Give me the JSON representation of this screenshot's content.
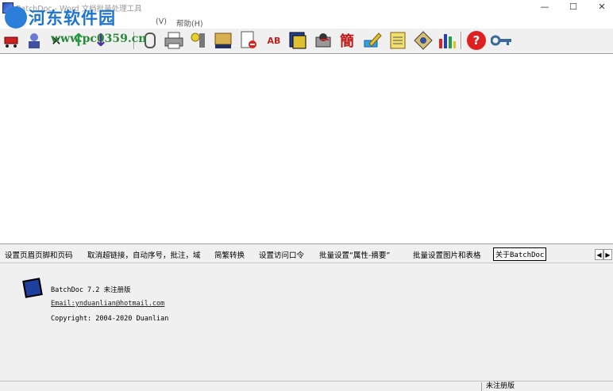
{
  "window": {
    "title": "BatchDoc - Word 文档批量处理工具",
    "minimize": "—",
    "maximize": "☐",
    "close": "✕"
  },
  "menu": {
    "items": [
      "(V)",
      "帮助(H)"
    ]
  },
  "watermark": {
    "text": "河东软件园",
    "url": "www.pc0359.cn"
  },
  "toolbar": {
    "icons": [
      "cart-icon",
      "user-icon",
      "delete-icon",
      "up-arrow-icon",
      "down-arrow-icon",
      "clip-icon",
      "printer-icon",
      "tools-icon",
      "name-card-icon",
      "stop-doc-icon",
      "ab-replace-icon",
      "word-icon",
      "disk-icon",
      "traditional-char-icon",
      "pencil-icon",
      "notepad-icon",
      "compass-icon",
      "chart-icon",
      "help-icon",
      "key-icon"
    ],
    "glyphs": {
      "delete": "✕",
      "up": "↑",
      "down": "↓",
      "ab": "AB",
      "trad": "簡",
      "help": "?"
    }
  },
  "tabs": [
    {
      "label": "设置页眉页脚和页码",
      "active": false
    },
    {
      "label": "取消超链接，自动序号，批注，域",
      "active": false
    },
    {
      "label": "简繁转换",
      "active": false
    },
    {
      "label": "设置访问口令",
      "active": false
    },
    {
      "label": "批量设置“属性-摘要”",
      "active": false
    },
    {
      "label": "批量设置图片和表格",
      "active": false
    },
    {
      "label": "关于BatchDoc",
      "active": true
    }
  ],
  "tab_scroll": {
    "left": "◀",
    "right": "▶"
  },
  "about": {
    "product": "BatchDoc 7.2 未注册版",
    "email": "Email:ynduanlian@hotmail.com",
    "copyright": "Copyright: 2004-2020 Duanlian"
  },
  "status": {
    "registration": "未注册版"
  },
  "colors": {
    "accent_blue": "#1d73d1",
    "watermark_green": "#2b8a3a",
    "help_red": "#e02020"
  }
}
